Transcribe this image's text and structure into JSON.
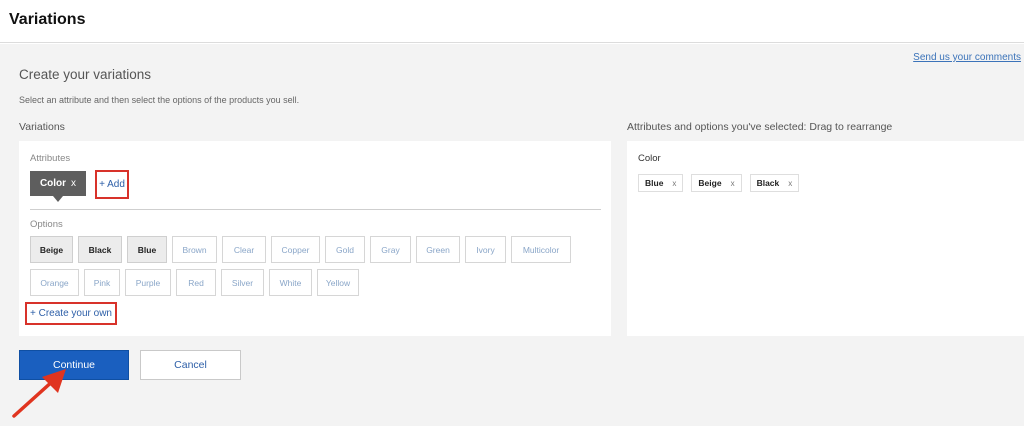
{
  "header": {
    "title": "Variations"
  },
  "feedback_link": "Send us your comments",
  "heading": "Create your variations",
  "subheading": "Select an attribute and then select the options of the products you sell.",
  "variations_label": "Variations",
  "selected_label": "Attributes and options you've selected: Drag to rearrange",
  "attributes": {
    "label": "Attributes",
    "chip_label": "Color",
    "chip_remove": "x",
    "add_label": "+ Add"
  },
  "options": {
    "label": "Options",
    "row1": [
      {
        "label": "Beige",
        "selected": true
      },
      {
        "label": "Black",
        "selected": true
      },
      {
        "label": "Blue",
        "selected": true
      },
      {
        "label": "Brown",
        "selected": false
      },
      {
        "label": "Clear",
        "selected": false
      },
      {
        "label": "Copper",
        "selected": false
      },
      {
        "label": "Gold",
        "selected": false
      },
      {
        "label": "Gray",
        "selected": false
      },
      {
        "label": "Green",
        "selected": false
      },
      {
        "label": "Ivory",
        "selected": false
      },
      {
        "label": "Multicolor",
        "selected": false
      }
    ],
    "row2": [
      {
        "label": "Orange",
        "selected": false
      },
      {
        "label": "Pink",
        "selected": false
      },
      {
        "label": "Purple",
        "selected": false
      },
      {
        "label": "Red",
        "selected": false
      },
      {
        "label": "Silver",
        "selected": false
      },
      {
        "label": "White",
        "selected": false
      },
      {
        "label": "Yellow",
        "selected": false
      }
    ],
    "create_own_label": "+ Create your own"
  },
  "selected": {
    "attribute": "Color",
    "values": [
      "Blue",
      "Beige",
      "Black"
    ],
    "remove": "x"
  },
  "buttons": {
    "continue": "Continue",
    "cancel": "Cancel"
  },
  "colors": {
    "primary": "#1a5fbf",
    "highlight_border": "#d8322a",
    "arrow": "#e0341f",
    "link": "#2d5fa8"
  }
}
